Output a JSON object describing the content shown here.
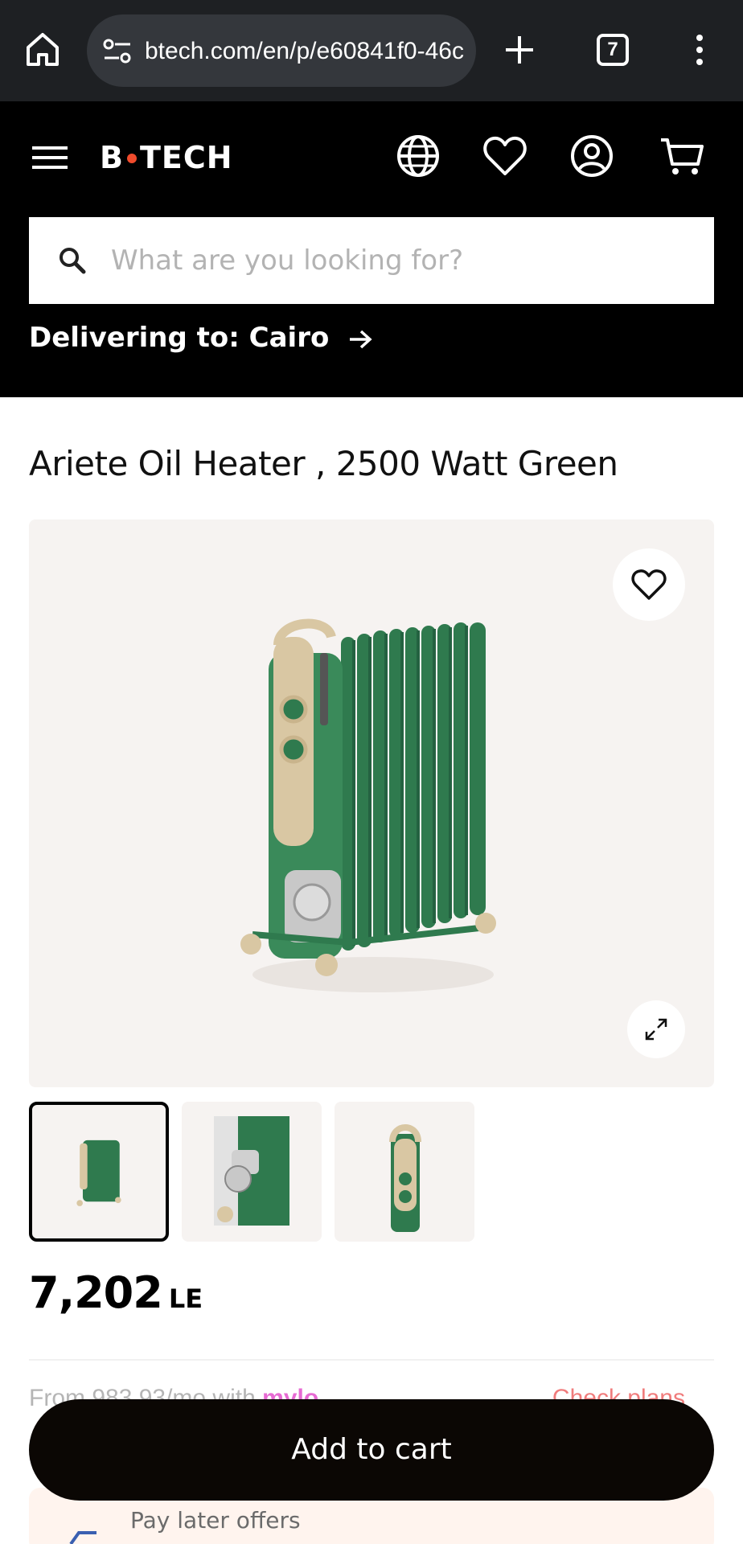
{
  "browser": {
    "url": "btech.com/en/p/e60841f0-46c",
    "tab_count": "7",
    "icons": [
      "home-icon",
      "site-settings-icon",
      "new-tab-icon",
      "tabs-icon",
      "more-menu-icon"
    ]
  },
  "header": {
    "logo_left": "B",
    "logo_right": "TECH",
    "search_placeholder": "What are you looking for?",
    "delivering_label": "Delivering to: Cairo",
    "icons": [
      "menu-icon",
      "globe-icon",
      "wishlist-icon",
      "account-icon",
      "cart-icon"
    ],
    "accent_color": "#f04b2c"
  },
  "product": {
    "title": "Ariete Oil Heater , 2500 Watt Green",
    "price": "7,202",
    "currency": "LE",
    "thumbnails": [
      "front",
      "detail",
      "side"
    ],
    "active_thumbnail": 0,
    "product_color": "#2f7a4e"
  },
  "installment": {
    "prefix": "From 983.93/mo with",
    "brand": "mylo",
    "link": "Check plans"
  },
  "paylater": {
    "label": "Pay later offers"
  },
  "actions": {
    "add_to_cart": "Add to cart"
  }
}
